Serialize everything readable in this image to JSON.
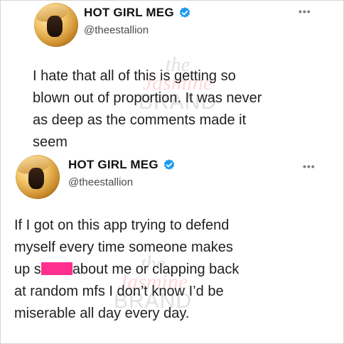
{
  "tweets": [
    {
      "display_name": "HOT GIRL MEG",
      "handle": "@theestallion",
      "more": "•••",
      "text": "I hate that all of this is getting so\nblown out of proportion. It was never\nas deep as the comments made it\nseem"
    },
    {
      "display_name": "HOT GIRL MEG",
      "handle": "@theestallion",
      "more": "•••",
      "text_part1": "If I got on this app trying to defend\nmyself every time someone makes\nup s",
      "text_part2": "about me or clapping back\nat random mfs I don’t know I’d be\nmiserable all day every day."
    }
  ],
  "watermark": {
    "line1": "the",
    "line2": "Jasmine",
    "line3": "BRAND"
  },
  "colors": {
    "verified": "#1d9bf0",
    "censor": "#ff2f8f"
  },
  "icons": {
    "verified": "verified-badge-icon",
    "more": "more-options-icon"
  }
}
